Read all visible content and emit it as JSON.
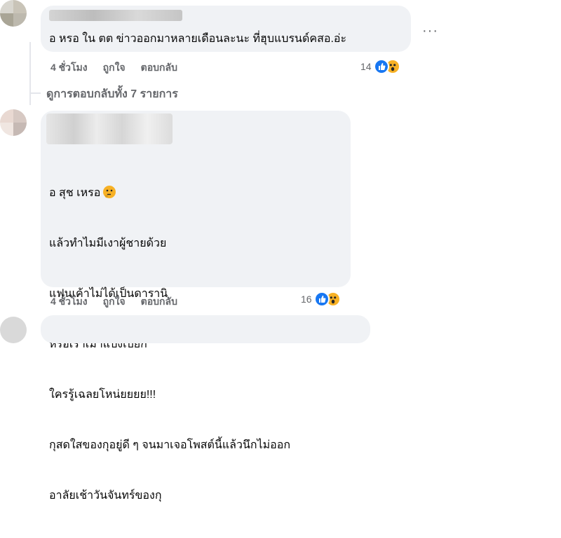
{
  "comment1": {
    "text": "อ หรอ ใน ตต ข่าวออกมาหลายเดือนละนะ ที่ฮุบแบรนด์คสอ.อ่ะ",
    "time": "4 ชั่วโมง",
    "like_label": "ถูกใจ",
    "reply_label": "ตอบกลับ",
    "reaction_count": "14",
    "more_label": "···"
  },
  "view_replies": "ดูการตอบกลับทั้ง 7 รายการ",
  "comment2": {
    "lines": [
      "อ สุช เหรอ",
      "แล้วทำไมมีเงาผู้ชายด้วย",
      "แฟนเค้าไม่ได้เป็นดารานิ",
      "หรือเราเมาแป้งเปียก",
      "ใครรู้เฉลยโหน่ยยยย!!!",
      "กุสดใสของกุอยู่ดี ๆ จนมาเจอโพสต์นี้แล้วนึกไม่ออก",
      "อาลัยเช้าวันจันทร์ของกุ"
    ],
    "time": "4 ชั่วโมง",
    "like_label": "ถูกใจ",
    "reply_label": "ตอบกลับ",
    "reaction_count": "16"
  },
  "colors": {
    "bubble": "#f0f2f5",
    "meta_text": "#65676b",
    "like_blue": "#1877f2",
    "wow_yellow": "#f7b125"
  },
  "icons": [
    "like-reaction-icon",
    "wow-reaction-icon",
    "thinking-emoji-icon",
    "more-options-icon"
  ]
}
